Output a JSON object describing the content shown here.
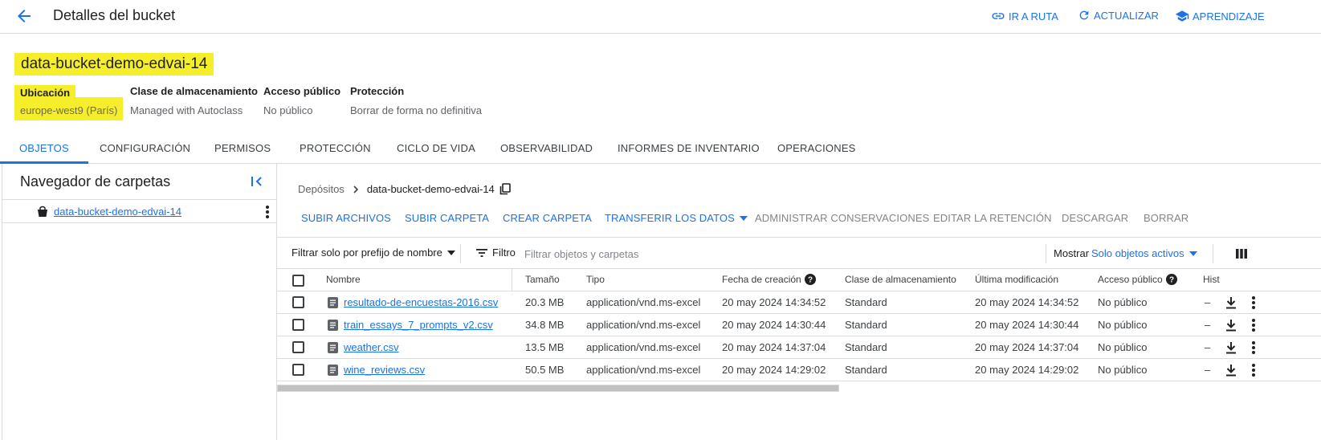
{
  "header": {
    "title": "Detalles del bucket",
    "actions": [
      {
        "label": "IR A RUTA",
        "icon": "link-icon"
      },
      {
        "label": "ACTUALIZAR",
        "icon": "refresh-icon"
      },
      {
        "label": "APRENDIZAJE",
        "icon": "school-icon"
      }
    ]
  },
  "bucket": {
    "name": "data-bucket-demo-edvai-14",
    "highlight_color": "#f6ee2a",
    "info": [
      {
        "label": "Ubicación",
        "value": "europe-west9 (París)"
      },
      {
        "label": "Clase de almacenamiento",
        "value": "Managed with Autoclass"
      },
      {
        "label": "Acceso público",
        "value": "No público"
      },
      {
        "label": "Protección",
        "value": "Borrar de forma no definitiva"
      }
    ]
  },
  "tabs": [
    "OBJETOS",
    "CONFIGURACIÓN",
    "PERMISOS",
    "PROTECCIÓN",
    "CICLO DE VIDA",
    "OBSERVABILIDAD",
    "INFORMES DE INVENTARIO",
    "OPERACIONES"
  ],
  "active_tab": "OBJETOS",
  "folder_browser": {
    "title": "Navegador de carpetas",
    "root": "data-bucket-demo-edvai-14"
  },
  "breadcrumb": {
    "root": "Depósitos",
    "current": "data-bucket-demo-edvai-14"
  },
  "actions": {
    "upload_files": "SUBIR ARCHIVOS",
    "upload_folder": "SUBIR CARPETA",
    "create_folder": "CREAR CARPETA",
    "transfer": "TRANSFERIR LOS DATOS",
    "manage_holds": "ADMINISTRAR CONSERVACIONES",
    "edit_retention": "EDITAR LA RETENCIÓN",
    "download": "DESCARGAR",
    "delete": "BORRAR"
  },
  "filter": {
    "prefix_label": "Filtrar solo por prefijo de nombre",
    "filter_label": "Filtro",
    "placeholder": "Filtrar objetos y carpetas",
    "show_label": "Mostrar",
    "show_value": "Solo objetos activos"
  },
  "table": {
    "columns": {
      "name": "Nombre",
      "size": "Tamaño",
      "type": "Tipo",
      "created": "Fecha de creación",
      "storage_class": "Clase de almacenamiento",
      "modified": "Última modificación",
      "public_access": "Acceso público",
      "history": "Historial"
    },
    "rows": [
      {
        "name": "resultado-de-encuestas-2016.csv",
        "size": "20.3 MB",
        "type": "application/vnd.ms-excel",
        "created": "20 may 2024 14:34:52",
        "storage_class": "Standard",
        "modified": "20 may 2024 14:34:52",
        "public_access": "No público",
        "history": "–"
      },
      {
        "name": "train_essays_7_prompts_v2.csv",
        "size": "34.8 MB",
        "type": "application/vnd.ms-excel",
        "created": "20 may 2024 14:30:44",
        "storage_class": "Standard",
        "modified": "20 may 2024 14:30:44",
        "public_access": "No público",
        "history": "–"
      },
      {
        "name": "weather.csv",
        "size": "13.5 MB",
        "type": "application/vnd.ms-excel",
        "created": "20 may 2024 14:37:04",
        "storage_class": "Standard",
        "modified": "20 may 2024 14:37:04",
        "public_access": "No público",
        "history": "–"
      },
      {
        "name": "wine_reviews.csv",
        "size": "50.5 MB",
        "type": "application/vnd.ms-excel",
        "created": "20 may 2024 14:29:02",
        "storage_class": "Standard",
        "modified": "20 may 2024 14:29:02",
        "public_access": "No público",
        "history": "–"
      }
    ]
  },
  "colors": {
    "accent": "#1a73e8",
    "highlight": "#f6ee2a"
  }
}
